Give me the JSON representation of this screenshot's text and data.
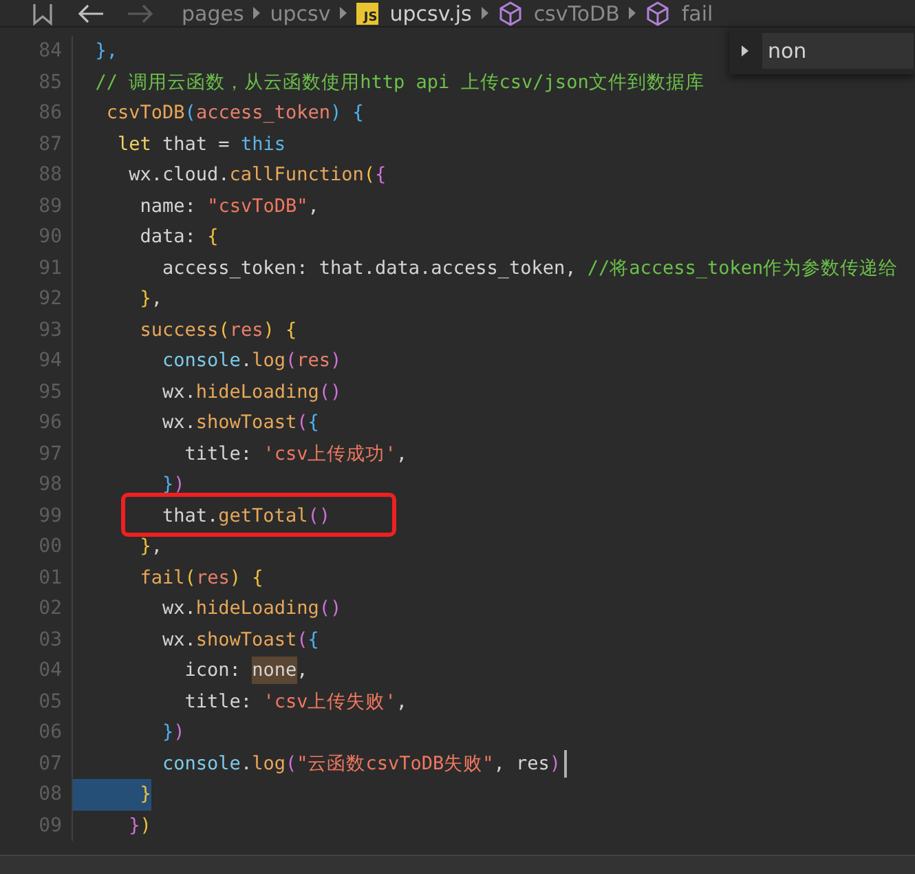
{
  "breadcrumb": {
    "items": [
      {
        "label": "pages",
        "kind": "folder"
      },
      {
        "label": "upcsv",
        "kind": "folder"
      },
      {
        "label": "upcsv.js",
        "kind": "file",
        "badge": "JS"
      },
      {
        "label": "csvToDB",
        "kind": "symbol"
      },
      {
        "label": "fail",
        "kind": "symbol"
      }
    ]
  },
  "find_widget": {
    "value": "non"
  },
  "lines": [
    {
      "number": "84",
      "selected": false,
      "cursor": false,
      "boxed": false,
      "tokens": [
        {
          "text": "  },",
          "kind": "b3"
        }
      ]
    },
    {
      "number": "85",
      "selected": false,
      "cursor": false,
      "boxed": false,
      "tokens": [
        {
          "text": "  // 调用云函数，从云函数使用http api 上传csv/json文件到数据库",
          "kind": "comment"
        }
      ]
    },
    {
      "number": "86",
      "selected": false,
      "cursor": false,
      "boxed": false,
      "tokens": [
        {
          "text": "   csvToDB",
          "kind": "fn"
        },
        {
          "text": "(",
          "kind": "b3"
        },
        {
          "text": "access_token",
          "kind": "param"
        },
        {
          "text": ")",
          "kind": "b3"
        },
        {
          "text": " {",
          "kind": "b3"
        }
      ]
    },
    {
      "number": "87",
      "selected": false,
      "cursor": false,
      "boxed": false,
      "tokens": [
        {
          "text": "    let",
          "kind": "kw"
        },
        {
          "text": " that = ",
          "kind": "plain"
        },
        {
          "text": "this",
          "kind": "kw2"
        }
      ]
    },
    {
      "number": "88",
      "selected": false,
      "cursor": false,
      "boxed": false,
      "tokens": [
        {
          "text": "     wx.cloud.",
          "kind": "plain"
        },
        {
          "text": "callFunction",
          "kind": "fn"
        },
        {
          "text": "(",
          "kind": "b1"
        },
        {
          "text": "{",
          "kind": "b2"
        }
      ]
    },
    {
      "number": "89",
      "selected": false,
      "cursor": false,
      "boxed": false,
      "tokens": [
        {
          "text": "      name: ",
          "kind": "plain"
        },
        {
          "text": "\"csvToDB\"",
          "kind": "str"
        },
        {
          "text": ",",
          "kind": "plain"
        }
      ]
    },
    {
      "number": "90",
      "selected": false,
      "cursor": false,
      "boxed": false,
      "tokens": [
        {
          "text": "      data: ",
          "kind": "plain"
        },
        {
          "text": "{",
          "kind": "b1"
        }
      ]
    },
    {
      "number": "91",
      "selected": false,
      "cursor": false,
      "boxed": false,
      "tokens": [
        {
          "text": "        access_token: that.data.access_token, ",
          "kind": "plain"
        },
        {
          "text": "//将access_token作为参数传递给",
          "kind": "comment"
        }
      ]
    },
    {
      "number": "92",
      "selected": false,
      "cursor": false,
      "boxed": false,
      "tokens": [
        {
          "text": "      }",
          "kind": "b1"
        },
        {
          "text": ",",
          "kind": "plain"
        }
      ]
    },
    {
      "number": "93",
      "selected": false,
      "cursor": false,
      "boxed": false,
      "tokens": [
        {
          "text": "      success",
          "kind": "fn"
        },
        {
          "text": "(",
          "kind": "b1"
        },
        {
          "text": "res",
          "kind": "param"
        },
        {
          "text": ")",
          "kind": "b1"
        },
        {
          "text": " {",
          "kind": "b1"
        }
      ]
    },
    {
      "number": "94",
      "selected": false,
      "cursor": false,
      "boxed": false,
      "tokens": [
        {
          "text": "        console",
          "kind": "obj"
        },
        {
          "text": ".",
          "kind": "plain"
        },
        {
          "text": "log",
          "kind": "fn"
        },
        {
          "text": "(",
          "kind": "b2"
        },
        {
          "text": "res",
          "kind": "param"
        },
        {
          "text": ")",
          "kind": "b2"
        }
      ]
    },
    {
      "number": "95",
      "selected": false,
      "cursor": false,
      "boxed": false,
      "tokens": [
        {
          "text": "        wx.",
          "kind": "plain"
        },
        {
          "text": "hideLoading",
          "kind": "fn"
        },
        {
          "text": "()",
          "kind": "b2"
        }
      ]
    },
    {
      "number": "96",
      "selected": false,
      "cursor": false,
      "boxed": false,
      "tokens": [
        {
          "text": "        wx.",
          "kind": "plain"
        },
        {
          "text": "showToast",
          "kind": "fn"
        },
        {
          "text": "(",
          "kind": "b2"
        },
        {
          "text": "{",
          "kind": "b3"
        }
      ]
    },
    {
      "number": "97",
      "selected": false,
      "cursor": false,
      "boxed": false,
      "tokens": [
        {
          "text": "          title: ",
          "kind": "plain"
        },
        {
          "text": "'csv上传成功'",
          "kind": "str"
        },
        {
          "text": ",",
          "kind": "plain"
        }
      ]
    },
    {
      "number": "98",
      "selected": false,
      "cursor": false,
      "boxed": false,
      "tokens": [
        {
          "text": "        }",
          "kind": "b3"
        },
        {
          "text": ")",
          "kind": "b2"
        }
      ]
    },
    {
      "number": "99",
      "selected": false,
      "cursor": false,
      "boxed": true,
      "tokens": [
        {
          "text": "        that.",
          "kind": "plain"
        },
        {
          "text": "getTotal",
          "kind": "fn"
        },
        {
          "text": "()",
          "kind": "b2"
        }
      ]
    },
    {
      "number": "00",
      "selected": false,
      "cursor": false,
      "boxed": false,
      "tokens": [
        {
          "text": "      }",
          "kind": "b1"
        },
        {
          "text": ",",
          "kind": "plain"
        }
      ]
    },
    {
      "number": "01",
      "selected": false,
      "cursor": false,
      "boxed": false,
      "tokens": [
        {
          "text": "      fail",
          "kind": "fn"
        },
        {
          "text": "(",
          "kind": "b1"
        },
        {
          "text": "res",
          "kind": "param"
        },
        {
          "text": ")",
          "kind": "b1"
        },
        {
          "text": " {",
          "kind": "b1"
        }
      ]
    },
    {
      "number": "02",
      "selected": false,
      "cursor": false,
      "boxed": false,
      "tokens": [
        {
          "text": "        wx.",
          "kind": "plain"
        },
        {
          "text": "hideLoading",
          "kind": "fn"
        },
        {
          "text": "()",
          "kind": "b2"
        }
      ]
    },
    {
      "number": "03",
      "selected": false,
      "cursor": false,
      "boxed": false,
      "tokens": [
        {
          "text": "        wx.",
          "kind": "plain"
        },
        {
          "text": "showToast",
          "kind": "fn"
        },
        {
          "text": "(",
          "kind": "b2"
        },
        {
          "text": "{",
          "kind": "b3"
        }
      ]
    },
    {
      "number": "04",
      "selected": false,
      "cursor": false,
      "boxed": false,
      "tokens": [
        {
          "text": "          icon: ",
          "kind": "plain"
        },
        {
          "text": "none",
          "kind": "match"
        },
        {
          "text": ",",
          "kind": "plain"
        }
      ]
    },
    {
      "number": "05",
      "selected": false,
      "cursor": false,
      "boxed": false,
      "tokens": [
        {
          "text": "          title: ",
          "kind": "plain"
        },
        {
          "text": "'csv上传失败'",
          "kind": "str"
        },
        {
          "text": ",",
          "kind": "plain"
        }
      ]
    },
    {
      "number": "06",
      "selected": false,
      "cursor": false,
      "boxed": false,
      "tokens": [
        {
          "text": "        }",
          "kind": "b3"
        },
        {
          "text": ")",
          "kind": "b2"
        }
      ]
    },
    {
      "number": "07",
      "selected": false,
      "cursor": true,
      "boxed": false,
      "tokens": [
        {
          "text": "        console",
          "kind": "obj"
        },
        {
          "text": ".",
          "kind": "plain"
        },
        {
          "text": "log",
          "kind": "fn"
        },
        {
          "text": "(",
          "kind": "b2"
        },
        {
          "text": "\"云函数csvToDB失败\"",
          "kind": "str"
        },
        {
          "text": ", res",
          "kind": "plain"
        },
        {
          "text": ")",
          "kind": "b2"
        }
      ]
    },
    {
      "number": "08",
      "selected": true,
      "cursor": false,
      "boxed": false,
      "tokens": [
        {
          "text": "      }",
          "kind": "b1"
        }
      ]
    },
    {
      "number": "09",
      "selected": false,
      "cursor": false,
      "boxed": false,
      "tokens": [
        {
          "text": "     }",
          "kind": "b2"
        },
        {
          "text": ")",
          "kind": "b1"
        }
      ]
    }
  ]
}
